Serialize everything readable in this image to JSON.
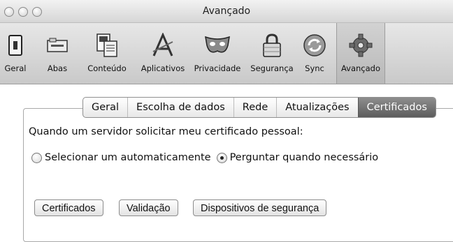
{
  "window": {
    "title": "Avançado"
  },
  "toolbar": {
    "items": [
      {
        "label": "Geral",
        "icon": "switch-icon"
      },
      {
        "label": "Abas",
        "icon": "tabs-icon"
      },
      {
        "label": "Conteúdo",
        "icon": "content-icon"
      },
      {
        "label": "Aplicativos",
        "icon": "applications-icon"
      },
      {
        "label": "Privacidade",
        "icon": "privacy-mask-icon"
      },
      {
        "label": "Segurança",
        "icon": "padlock-icon"
      },
      {
        "label": "Sync",
        "icon": "sync-icon"
      },
      {
        "label": "Avançado",
        "icon": "gear-icon",
        "selected": true
      }
    ]
  },
  "tabs": {
    "items": [
      {
        "label": "Geral"
      },
      {
        "label": "Escolha de dados"
      },
      {
        "label": "Rede"
      },
      {
        "label": "Atualizações"
      },
      {
        "label": "Certificados",
        "selected": true
      }
    ]
  },
  "certificates": {
    "prompt": "Quando um servidor solicitar meu certificado pessoal:",
    "option_auto": "Selecionar um automaticamente",
    "option_ask": "Perguntar quando necessário",
    "selected_option": "ask",
    "buttons": {
      "certificates": "Certificados",
      "validation": "Validação",
      "security_devices": "Dispositivos de segurança"
    }
  }
}
